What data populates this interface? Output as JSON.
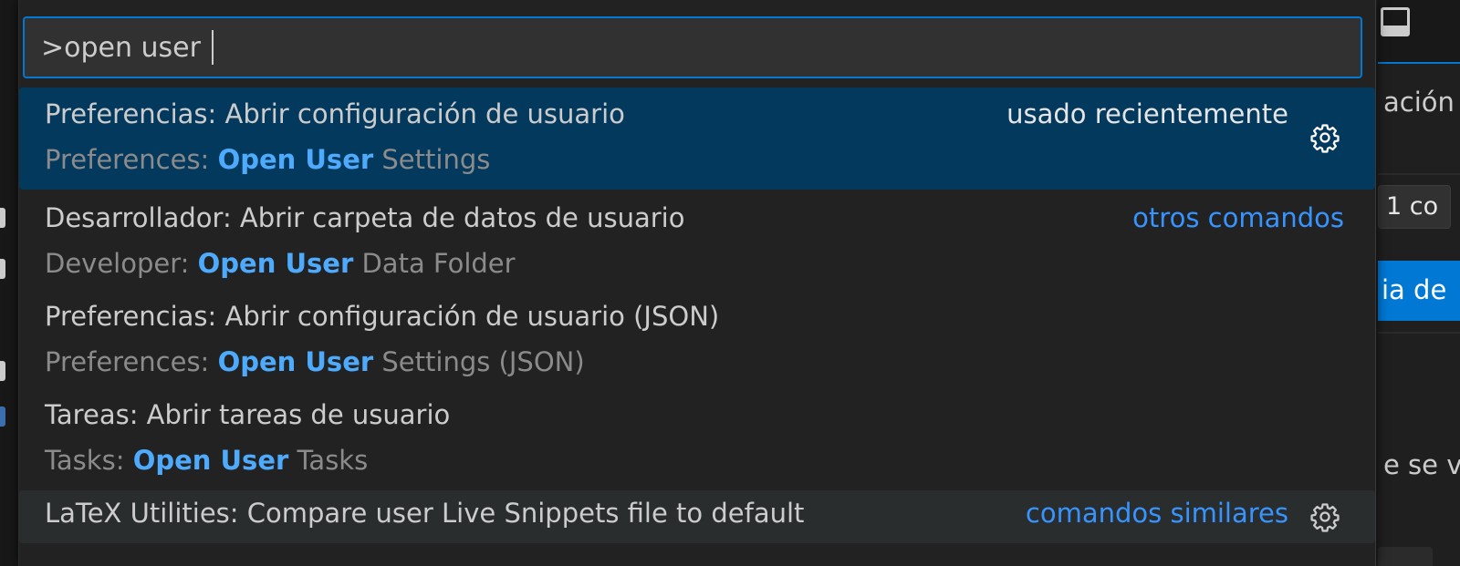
{
  "background": {
    "fragment_top": "ación",
    "fragment_chip": "1 co",
    "fragment_button": "ia de",
    "fragment_bottom": "e se v"
  },
  "palette": {
    "input_value": ">open user ",
    "items": [
      {
        "title": "Preferencias: Abrir configuración de usuario",
        "sub_prefix": "Preferences: ",
        "sub_highlight": "Open User",
        "sub_suffix": " Settings",
        "right_label": "usado recientemente"
      },
      {
        "title": "Desarrollador: Abrir carpeta de datos de usuario",
        "sub_prefix": "Developer: ",
        "sub_highlight": "Open User",
        "sub_suffix": " Data Folder",
        "right_label": "otros comandos"
      },
      {
        "title": "Preferencias: Abrir configuración de usuario (JSON)",
        "sub_prefix": "Preferences: ",
        "sub_highlight": "Open User",
        "sub_suffix": " Settings (JSON)"
      },
      {
        "title": "Tareas: Abrir tareas de usuario",
        "sub_prefix": "Tasks: ",
        "sub_highlight": "Open User",
        "sub_suffix": " Tasks"
      },
      {
        "title": "LaTeX Utilities: Compare user Live Snippets file to default",
        "right_label": "comandos similares"
      }
    ]
  },
  "icons": {
    "gear": "gear-icon",
    "layout": "layout-panel-icon"
  },
  "colors": {
    "accent": "#0078d4",
    "selected_bg": "#04395e",
    "highlight": "#4daafc",
    "link": "#3794ff"
  }
}
